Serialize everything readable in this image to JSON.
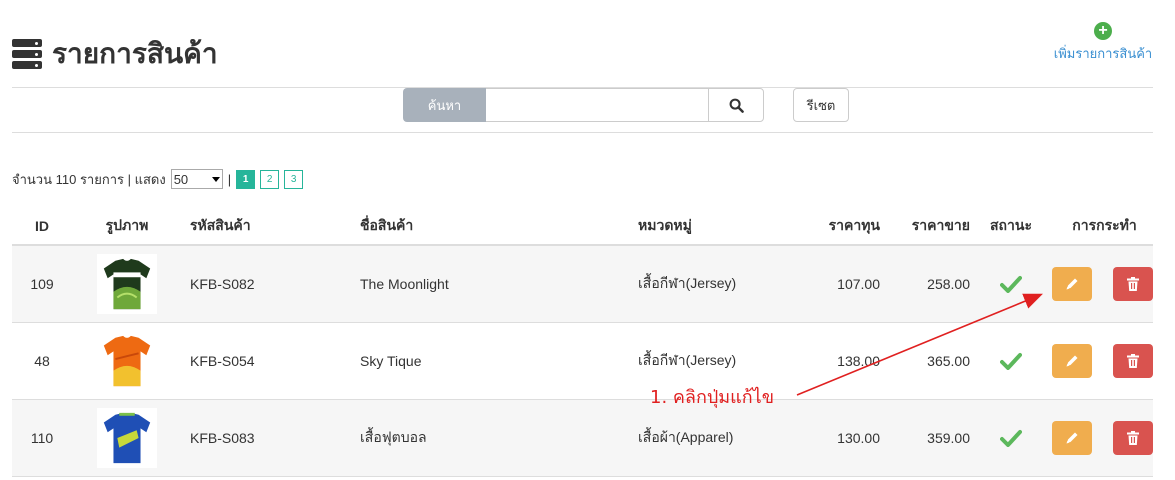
{
  "header": {
    "title": "รายการสินค้า",
    "add_label": "เพิ่มรายการสินค้า"
  },
  "search": {
    "addon_label": "ค้นหา",
    "value": "",
    "placeholder": "",
    "reset_label": "รีเซต"
  },
  "summary": {
    "count_text": "จำนวน 110 รายการ | แสดง",
    "per_page": "50",
    "separator": "|",
    "pages": [
      "1",
      "2",
      "3"
    ],
    "active_page": "1"
  },
  "table": {
    "columns": [
      "ID",
      "รูปภาพ",
      "รหัสสินค้า",
      "ชื่อสินค้า",
      "หมวดหมู่",
      "ราคาทุน",
      "ราคาขาย",
      "สถานะ",
      "การกระทำ"
    ],
    "rows": [
      {
        "id": "109",
        "code": "KFB-S082",
        "name": "The Moonlight",
        "category": "เสื้อกีฬา(Jersey)",
        "cost": "107.00",
        "price": "258.00"
      },
      {
        "id": "48",
        "code": "KFB-S054",
        "name": "Sky Tique",
        "category": "เสื้อกีฬา(Jersey)",
        "cost": "138.00",
        "price": "365.00"
      },
      {
        "id": "110",
        "code": "KFB-S083",
        "name": "เสื้อฟุตบอล",
        "category": "เสื้อผ้า(Apparel)",
        "cost": "130.00",
        "price": "359.00"
      }
    ]
  },
  "annotation": {
    "text": "1. คลิกปุ่มแก้ไข",
    "color": "#e02020"
  },
  "colors": {
    "accent": "#26b59a",
    "edit": "#f0ad4e",
    "delete": "#d9534f",
    "status_ok": "#5cb85c",
    "link": "#3a8fd1"
  },
  "icons": {
    "header": "list-icon",
    "add": "plus-circle-icon",
    "search": "search-icon",
    "status": "check-icon",
    "edit": "pencil-icon",
    "delete": "trash-icon"
  }
}
